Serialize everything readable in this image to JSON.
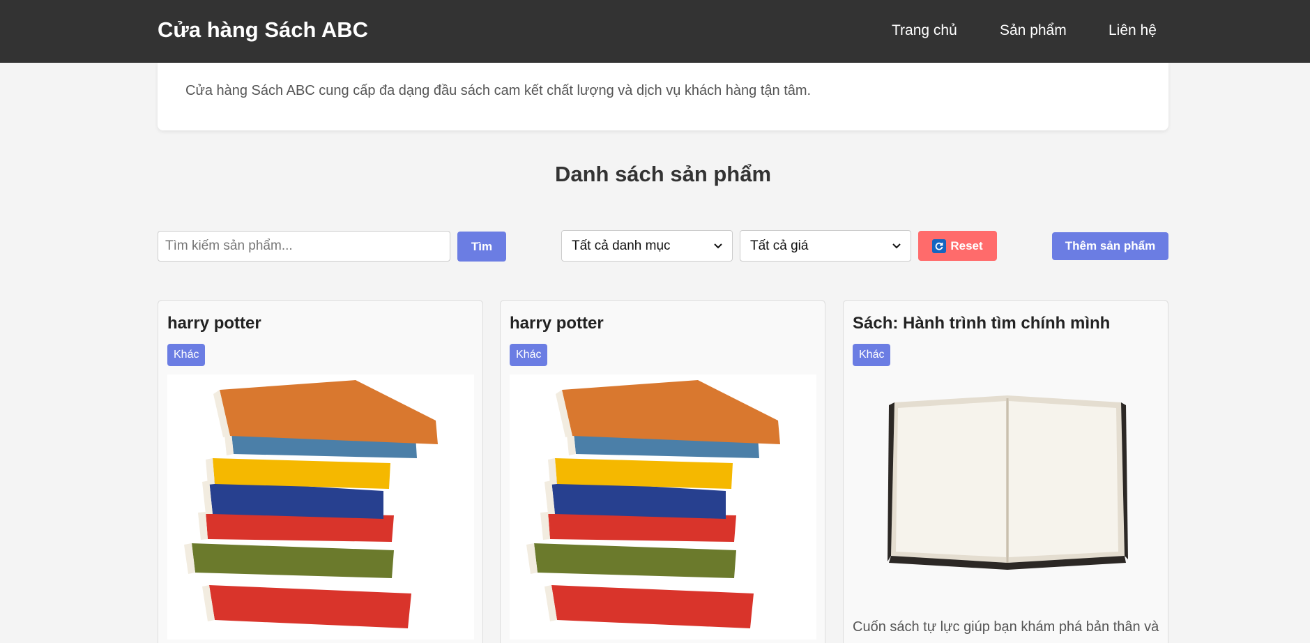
{
  "header": {
    "brand": "Cửa hàng Sách ABC",
    "nav": [
      "Trang chủ",
      "Sản phẩm",
      "Liên hệ"
    ]
  },
  "intro": {
    "text": "Cửa hàng Sách ABC cung cấp đa dạng đầu sách cam kết chất lượng và dịch vụ khách hàng tận tâm."
  },
  "products_section": {
    "title": "Danh sách sản phẩm"
  },
  "toolbar": {
    "search_placeholder": "Tìm kiếm sản phẩm...",
    "search_button": "Tìm",
    "category_selected": "Tất cả danh mục",
    "price_selected": "Tất cả giá",
    "reset_button": "Reset",
    "add_button": "Thêm sản phẩm"
  },
  "products": [
    {
      "title": "harry potter",
      "category": "Khác",
      "image": "stack-of-books",
      "description": ""
    },
    {
      "title": "harry potter",
      "category": "Khác",
      "image": "stack-of-books",
      "description": ""
    },
    {
      "title": "Sách: Hành trình tìm chính mình",
      "category": "Khác",
      "image": "open-blank-book",
      "description": "Cuốn sách tự lực giúp bạn khám phá bản thân và"
    }
  ],
  "colors": {
    "header_bg": "#333333",
    "accent": "#6b7de3",
    "danger": "#ff6b6b",
    "page_bg": "#f4f4f4"
  }
}
